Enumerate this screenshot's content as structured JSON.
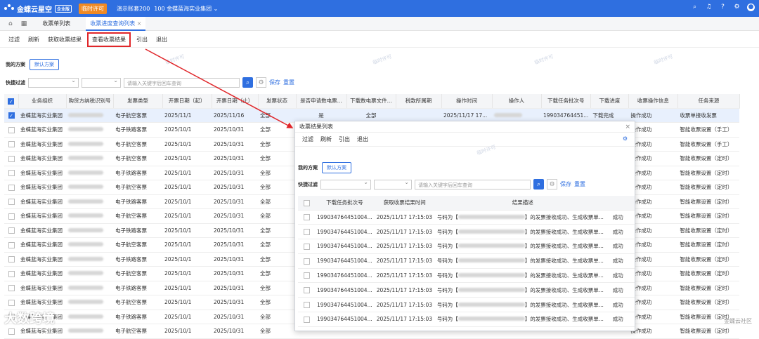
{
  "topbar": {
    "brand": "金蝶云星空",
    "edition": "企业版",
    "trial": "临时许可",
    "account": "演示账套200",
    "org": "100 金蝶蓝海实业集团",
    "org_arrow": "⌄"
  },
  "tabs": [
    {
      "label": "收票单列表"
    },
    {
      "label": "收票进度查询列表",
      "close": "×"
    }
  ],
  "toolbar": [
    "过滤",
    "刷新",
    "获取收票结果",
    "查看收票结果",
    "引出",
    "退出"
  ],
  "scheme": {
    "label": "我的方案",
    "default": "默认方案"
  },
  "filter": {
    "label": "快捷过滤",
    "placeholder": "请输入关键字后回车查询",
    "save": "保存",
    "reset": "重置"
  },
  "main_table": {
    "columns": [
      "业务组织",
      "购货方纳税识别号",
      "发票类型",
      "开票日期（起）",
      "开票日期（止）",
      "发票状态",
      "是否申请数电票...",
      "下载数电票文件...",
      "税款所属期",
      "操作时间",
      "操作人",
      "下载任务批次号",
      "下载进度",
      "收票操作信息",
      "任务来源"
    ],
    "rows": [
      [
        "金蝶蓝海实业集团",
        "",
        "电子航空客票",
        "2025/11/1",
        "2025/11/16",
        "全部",
        "是",
        "全部",
        "",
        "2025/11/17 17...",
        "",
        "199034764451...",
        "下载完成",
        "操作成功",
        "收票单接收发票"
      ],
      [
        "金蝶蓝海实业集团",
        "",
        "电子铁路客票",
        "2025/10/1",
        "2025/10/31",
        "全部",
        "",
        "",
        "",
        "",
        "",
        "",
        "",
        "操作成功",
        "智能收票设置（手工）"
      ],
      [
        "金蝶蓝海实业集团",
        "",
        "电子航空客票",
        "2025/10/1",
        "2025/10/31",
        "全部",
        "",
        "",
        "",
        "",
        "",
        "",
        "",
        "操作成功",
        "智能收票设置（手工）"
      ],
      [
        "金蝶蓝海实业集团",
        "",
        "电子航空客票",
        "2025/10/1",
        "2025/10/31",
        "全部",
        "",
        "",
        "",
        "",
        "",
        "",
        "",
        "操作成功",
        "智能收票设置（定时）"
      ],
      [
        "金蝶蓝海实业集团",
        "",
        "电子铁路客票",
        "2025/10/1",
        "2025/10/31",
        "全部",
        "",
        "",
        "",
        "",
        "",
        "",
        "",
        "操作成功",
        "智能收票设置（定时）"
      ],
      [
        "金蝶蓝海实业集团",
        "",
        "电子航空客票",
        "2025/10/1",
        "2025/10/31",
        "全部",
        "",
        "",
        "",
        "",
        "",
        "",
        "",
        "操作成功",
        "智能收票设置（定时）"
      ],
      [
        "金蝶蓝海实业集团",
        "",
        "电子铁路客票",
        "2025/10/1",
        "2025/10/31",
        "全部",
        "",
        "",
        "",
        "",
        "",
        "",
        "",
        "操作成功",
        "智能收票设置（定时）"
      ],
      [
        "金蝶蓝海实业集团",
        "",
        "电子航空客票",
        "2025/10/1",
        "2025/10/31",
        "全部",
        "",
        "",
        "",
        "",
        "",
        "",
        "",
        "操作成功",
        "智能收票设置（定时）"
      ],
      [
        "金蝶蓝海实业集团",
        "",
        "电子铁路客票",
        "2025/10/1",
        "2025/10/31",
        "全部",
        "",
        "",
        "",
        "",
        "",
        "",
        "",
        "操作成功",
        "智能收票设置（定时）"
      ],
      [
        "金蝶蓝海实业集团",
        "",
        "电子航空客票",
        "2025/10/1",
        "2025/10/31",
        "全部",
        "",
        "",
        "",
        "",
        "",
        "",
        "",
        "操作成功",
        "智能收票设置（定时）"
      ],
      [
        "金蝶蓝海实业集团",
        "",
        "电子铁路客票",
        "2025/10/1",
        "2025/10/31",
        "全部",
        "",
        "",
        "",
        "",
        "",
        "",
        "",
        "操作成功",
        "智能收票设置（定时）"
      ],
      [
        "金蝶蓝海实业集团",
        "",
        "电子航空客票",
        "2025/10/1",
        "2025/10/31",
        "全部",
        "",
        "",
        "",
        "",
        "",
        "",
        "",
        "操作成功",
        "智能收票设置（定时）"
      ],
      [
        "金蝶蓝海实业集团",
        "",
        "电子铁路客票",
        "2025/10/1",
        "2025/10/31",
        "全部",
        "",
        "",
        "",
        "",
        "",
        "",
        "",
        "操作成功",
        "智能收票设置（定时）"
      ],
      [
        "金蝶蓝海实业集团",
        "",
        "电子航空客票",
        "2025/10/1",
        "2025/10/31",
        "全部",
        "",
        "",
        "",
        "",
        "",
        "",
        "",
        "操作成功",
        "智能收票设置（定时）"
      ],
      [
        "金蝶蓝海实业集团",
        "",
        "电子铁路客票",
        "2025/10/1",
        "2025/10/31",
        "全部",
        "",
        "",
        "",
        "",
        "",
        "",
        "",
        "操作成功",
        "智能收票设置（定时）"
      ],
      [
        "金蝶蓝海实业集团",
        "",
        "电子航空客票",
        "2025/10/1",
        "2025/10/31",
        "全部",
        "",
        "",
        "",
        "",
        "",
        "",
        "",
        "操作成功",
        "智能收票设置（定时）"
      ]
    ]
  },
  "popup": {
    "title": "收票结果列表",
    "close": "×",
    "toolbar": [
      "过滤",
      "刷新",
      "引出",
      "退出"
    ],
    "columns": [
      "下载任务批次号",
      "获取收票结果时间",
      "结果描述",
      ""
    ],
    "rows": [
      [
        "199034764451004...",
        "2025/11/17 17:15:03",
        "号码为【",
        "】的发票接收成功、生成收票单...",
        "成功"
      ],
      [
        "199034764451004...",
        "2025/11/17 17:15:03",
        "号码为【",
        "】的发票接收成功、生成收票单...",
        "成功"
      ],
      [
        "199034764451004...",
        "2025/11/17 17:15:03",
        "号码为【",
        "】的发票接收成功、生成收票单...",
        "成功"
      ],
      [
        "199034764451004...",
        "2025/11/17 17:15:03",
        "号码为【",
        "】的发票接收成功、生成收票单...",
        "成功"
      ],
      [
        "199034764451004...",
        "2025/11/17 17:15:03",
        "号码为【",
        "】的发票接收成功、生成收票单...",
        "成功"
      ],
      [
        "199034764451004...",
        "2025/11/17 17:15:03",
        "号码为【",
        "】的发票接收成功、生成收票单...",
        "成功"
      ],
      [
        "199034764451004...",
        "2025/11/17 17:15:03",
        "号码为【",
        "】的发票接收成功、生成收票单...",
        "成功"
      ],
      [
        "199034764451004...",
        "2025/11/17 17:15:03",
        "号码为【",
        "】的发票接收成功、生成收票单...",
        "成功"
      ]
    ]
  },
  "watermark": "临时许可",
  "overlay": {
    "brand": "大数跨境",
    "corner": "金蝶云社区"
  },
  "colors": {
    "primary": "#2f6fe0",
    "highlight": "#e0262a",
    "trial": "#f08a24"
  }
}
